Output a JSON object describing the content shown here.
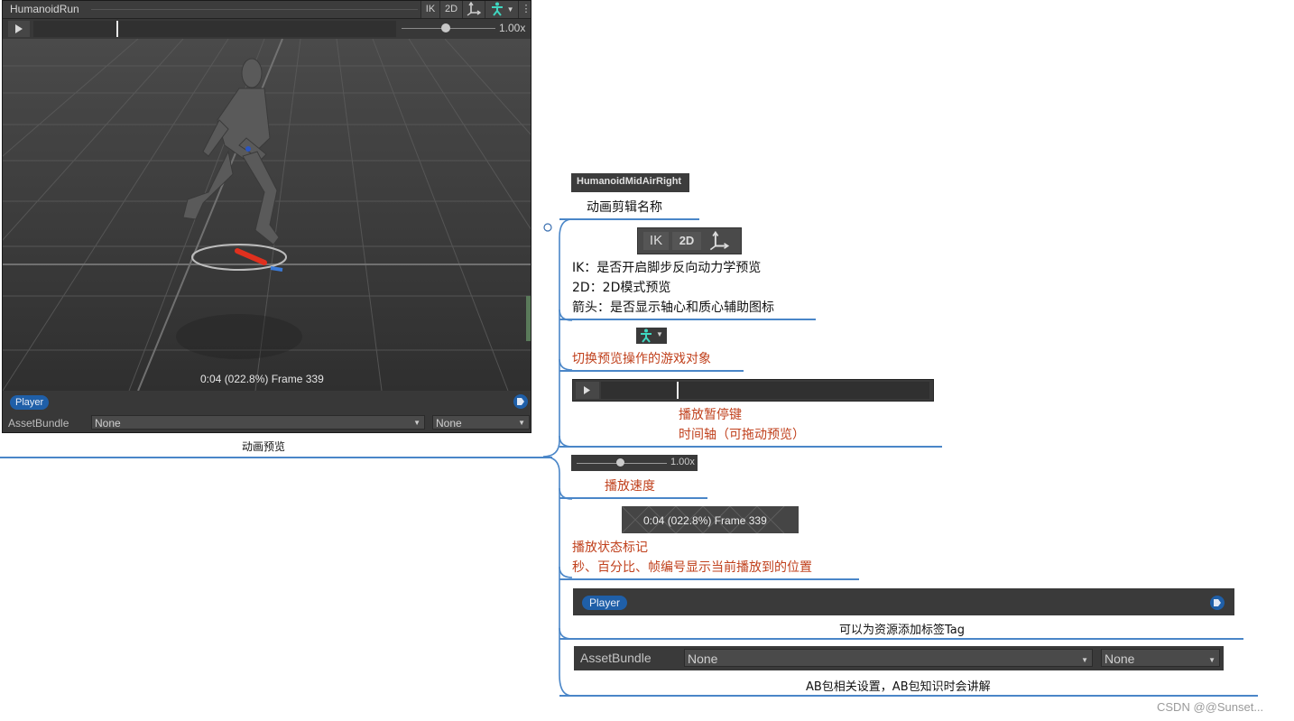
{
  "preview_window": {
    "title": "HumanoidRun",
    "buttons": {
      "ik": "IK",
      "two_d": "2D"
    },
    "speed_label": "1.00x",
    "speed_value": 1.0,
    "timeline_progress": 0.228,
    "status_text": "0:04 (022.8%) Frame 339",
    "tag_label": "Player",
    "assetbundle_label": "AssetBundle",
    "assetbundle_name": "None",
    "assetbundle_variant": "None"
  },
  "preview_caption": "动画预览",
  "annotations": {
    "clip_name": {
      "snippet": "HumanoidMidAirRight",
      "label": "动画剪辑名称"
    },
    "toolbar": {
      "snippet_ik": "IK",
      "snippet_2d": "2D",
      "lines": [
        "IK：是否开启脚步反向动力学预览",
        "2D：2D模式预览",
        "箭头：是否显示轴心和质心辅助图标"
      ]
    },
    "avatar": {
      "label": "切换预览操作的游戏对象"
    },
    "timeline": {
      "lines": [
        "播放暂停键",
        "时间轴（可拖动预览）"
      ]
    },
    "speed": {
      "snippet": "1.00x",
      "label": "播放速度"
    },
    "status": {
      "snippet": "0:04 (022.8%) Frame 339",
      "lines": [
        "播放状态标记",
        "秒、百分比、帧编号显示当前播放到的位置"
      ]
    },
    "tag": {
      "snippet": "Player",
      "label": "可以为资源添加标签Tag"
    },
    "assetbundle": {
      "snippet_label": "AssetBundle",
      "snippet_name": "None",
      "snippet_variant": "None",
      "label": "AB包相关设置，AB包知识时会讲解"
    }
  },
  "watermark": "CSDN @@Sunset...",
  "colors": {
    "accent_blue": "#4a86c8",
    "note_red": "#c0401c",
    "tag_blue": "#1f5fa8",
    "avatar_teal": "#3fd6c0"
  },
  "icons": [
    "play-icon",
    "pivot-arrows-icon",
    "avatar-icon",
    "menu-dots-icon",
    "tag-icon",
    "dropdown-arrow-icon"
  ]
}
